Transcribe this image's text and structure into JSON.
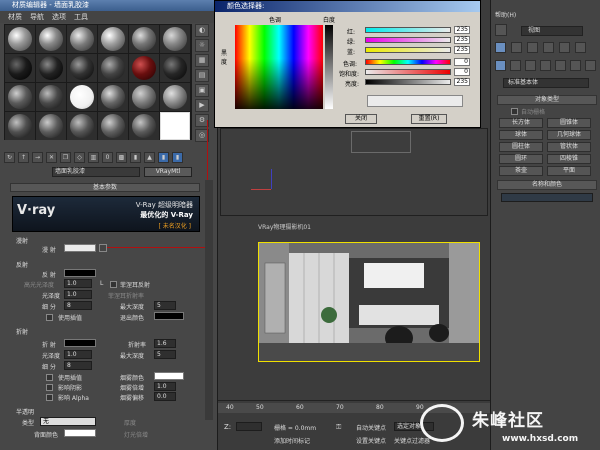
{
  "material_editor": {
    "title": "材质编辑器 - 墙面乳胶漆",
    "menu": [
      "材质",
      "导航",
      "选项",
      "工具"
    ],
    "material_name": "墙面乳胶漆",
    "material_type": "VRayMtl",
    "rollout_basic": "基本参数",
    "vray_banner": {
      "logo": "V·ray",
      "line1": "V-Ray 超级明暗器",
      "line2": "最优化的 V-Ray",
      "line3": "[ 未名汉化 ]"
    },
    "diffuse": {
      "section": "漫射",
      "label": "漫  射"
    },
    "reflection": {
      "section": "反射",
      "reflect_label": "反  射",
      "hilight_label": "高光光泽度",
      "hilight_value": "1.0",
      "gloss_label": "光泽度",
      "gloss_value": "1.0",
      "subdiv_label": "细  分",
      "subdiv_value": "8",
      "use_interp": "使用插值",
      "lock": "L",
      "fresnel": "菲涅耳反射",
      "fresnel_ior_label": "菲涅耳折射率",
      "max_depth_label": "最大深度",
      "max_depth_value": "5",
      "exit_color_label": "退出颜色"
    },
    "refraction": {
      "section": "折射",
      "refract_label": "折  射",
      "gloss_label": "光泽度",
      "gloss_value": "1.0",
      "subdiv_label": "细  分",
      "subdiv_value": "8",
      "ior_label": "折射率",
      "ior_value": "1.6",
      "max_depth_label": "最大深度",
      "max_depth_value": "5",
      "use_interp": "使用插值",
      "shadow": "影响阴影",
      "alpha": "影响 Alpha",
      "fog_color": "烟雾颜色",
      "fog_mult": "烟雾倍增",
      "fog_mult_value": "1.0",
      "fog_bias": "烟雾偏移",
      "fog_bias_value": "0.0"
    },
    "translucency": {
      "section": "半透明",
      "type_label": "类型",
      "type_value": "无",
      "back_color": "背面颜色",
      "thickness": "厚度",
      "light_mult": "灯光倍增"
    }
  },
  "color_picker": {
    "title": "颜色选择器:",
    "hue_label": "色调",
    "whiteness_label": "白度",
    "blackness_label": "黑度",
    "channels": [
      {
        "label": "红:",
        "value": "235"
      },
      {
        "label": "绿:",
        "value": "235"
      },
      {
        "label": "蓝:",
        "value": "235"
      },
      {
        "label": "色调:",
        "value": "0"
      },
      {
        "label": "饱和度:",
        "value": "0"
      },
      {
        "label": "亮度:",
        "value": "235"
      }
    ],
    "close_button": "关闭",
    "reset_button": "重置(R)",
    "preview_color": "#ebebeb"
  },
  "viewport": {
    "render_label": "VRay物理摄影机01"
  },
  "command_panel": {
    "help": "帮助(H)",
    "view_dropdown": "视图",
    "category_dropdown": "标准基本体",
    "object_type_header": "对象类型",
    "auto_grid": "自动栅格",
    "objects": [
      "长方体",
      "圆锥体",
      "球体",
      "几何球体",
      "圆柱体",
      "管状体",
      "圆环",
      "四棱锥",
      "茶壶",
      "平面"
    ],
    "name_color_header": "名称和颜色"
  },
  "bottom_bar": {
    "ruler": [
      "40",
      "50",
      "60",
      "70",
      "80",
      "90"
    ],
    "z_label": "Z:",
    "grid_label": "栅格 = 0.0mm",
    "auto_key": "自动关键点",
    "selected": "选定对象",
    "set_key": "设置关键点",
    "add_time_tag": "添加时间标记",
    "key_filter": "关键点过滤器"
  },
  "watermark": {
    "brand": "朱峰社区",
    "url": "www.hxsd.com"
  }
}
